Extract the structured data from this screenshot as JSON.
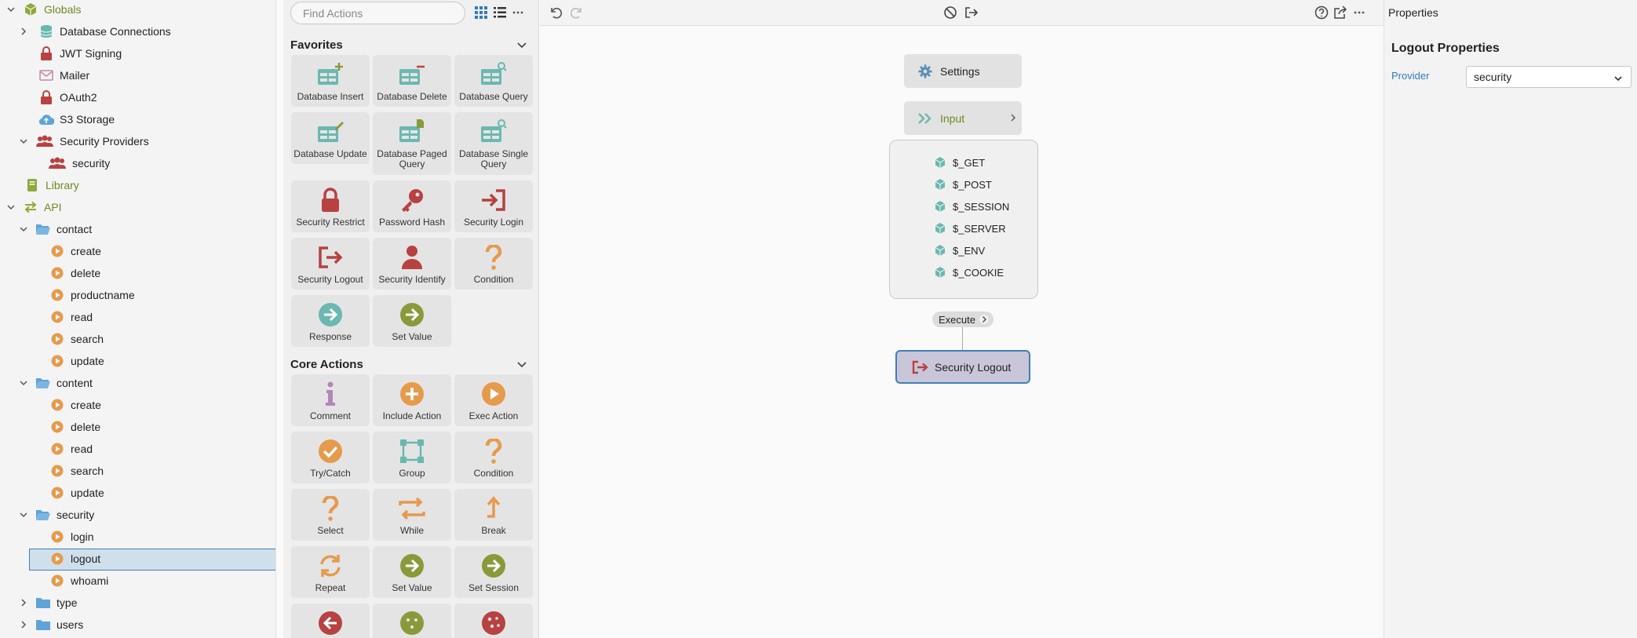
{
  "tree": {
    "globals": "Globals",
    "database_connections": "Database Connections",
    "jwt_signing": "JWT Signing",
    "mailer": "Mailer",
    "oauth2": "OAuth2",
    "s3_storage": "S3 Storage",
    "security_providers": "Security Providers",
    "security_provider": "security",
    "library": "Library",
    "api": "API",
    "contact": "contact",
    "contact_items": [
      "create",
      "delete",
      "productname",
      "read",
      "search",
      "update"
    ],
    "content": "content",
    "content_items": [
      "create",
      "delete",
      "read",
      "search",
      "update"
    ],
    "security": "security",
    "security_items": [
      "login",
      "logout",
      "whoami"
    ],
    "type": "type",
    "users": "users"
  },
  "toolbox": {
    "search_placeholder": "Find Actions",
    "favorites_title": "Favorites",
    "favorites": [
      "Database Insert",
      "Database Delete",
      "Database Query",
      "Database Update",
      "Database Paged Query",
      "Database Single Query",
      "Security Restrict",
      "Password Hash",
      "Security Login",
      "Security Logout",
      "Security Identify",
      "Condition",
      "Response",
      "Set Value"
    ],
    "core_title": "Core Actions",
    "core": [
      "Comment",
      "Include Action",
      "Exec Action",
      "Try/Catch",
      "Group",
      "Condition",
      "Select",
      "While",
      "Break",
      "Repeat",
      "Set Value",
      "Set Session"
    ]
  },
  "canvas": {
    "settings": "Settings",
    "input": "Input",
    "globals": [
      "$_GET",
      "$_POST",
      "$_SESSION",
      "$_SERVER",
      "$_ENV",
      "$_COOKIE"
    ],
    "execute": "Execute",
    "step": "Security Logout"
  },
  "properties": {
    "header": "Properties",
    "title": "Logout Properties",
    "provider_label": "Provider",
    "provider_value": "security"
  },
  "colors": {
    "accent_blue": "#2f7bc1",
    "folder_blue": "#5fa3d8",
    "teal": "#6bb8b0",
    "orange": "#e69a4c",
    "red": "#b84141",
    "olive": "#8a9a3a",
    "selected_bg": "#cfe0ec"
  }
}
